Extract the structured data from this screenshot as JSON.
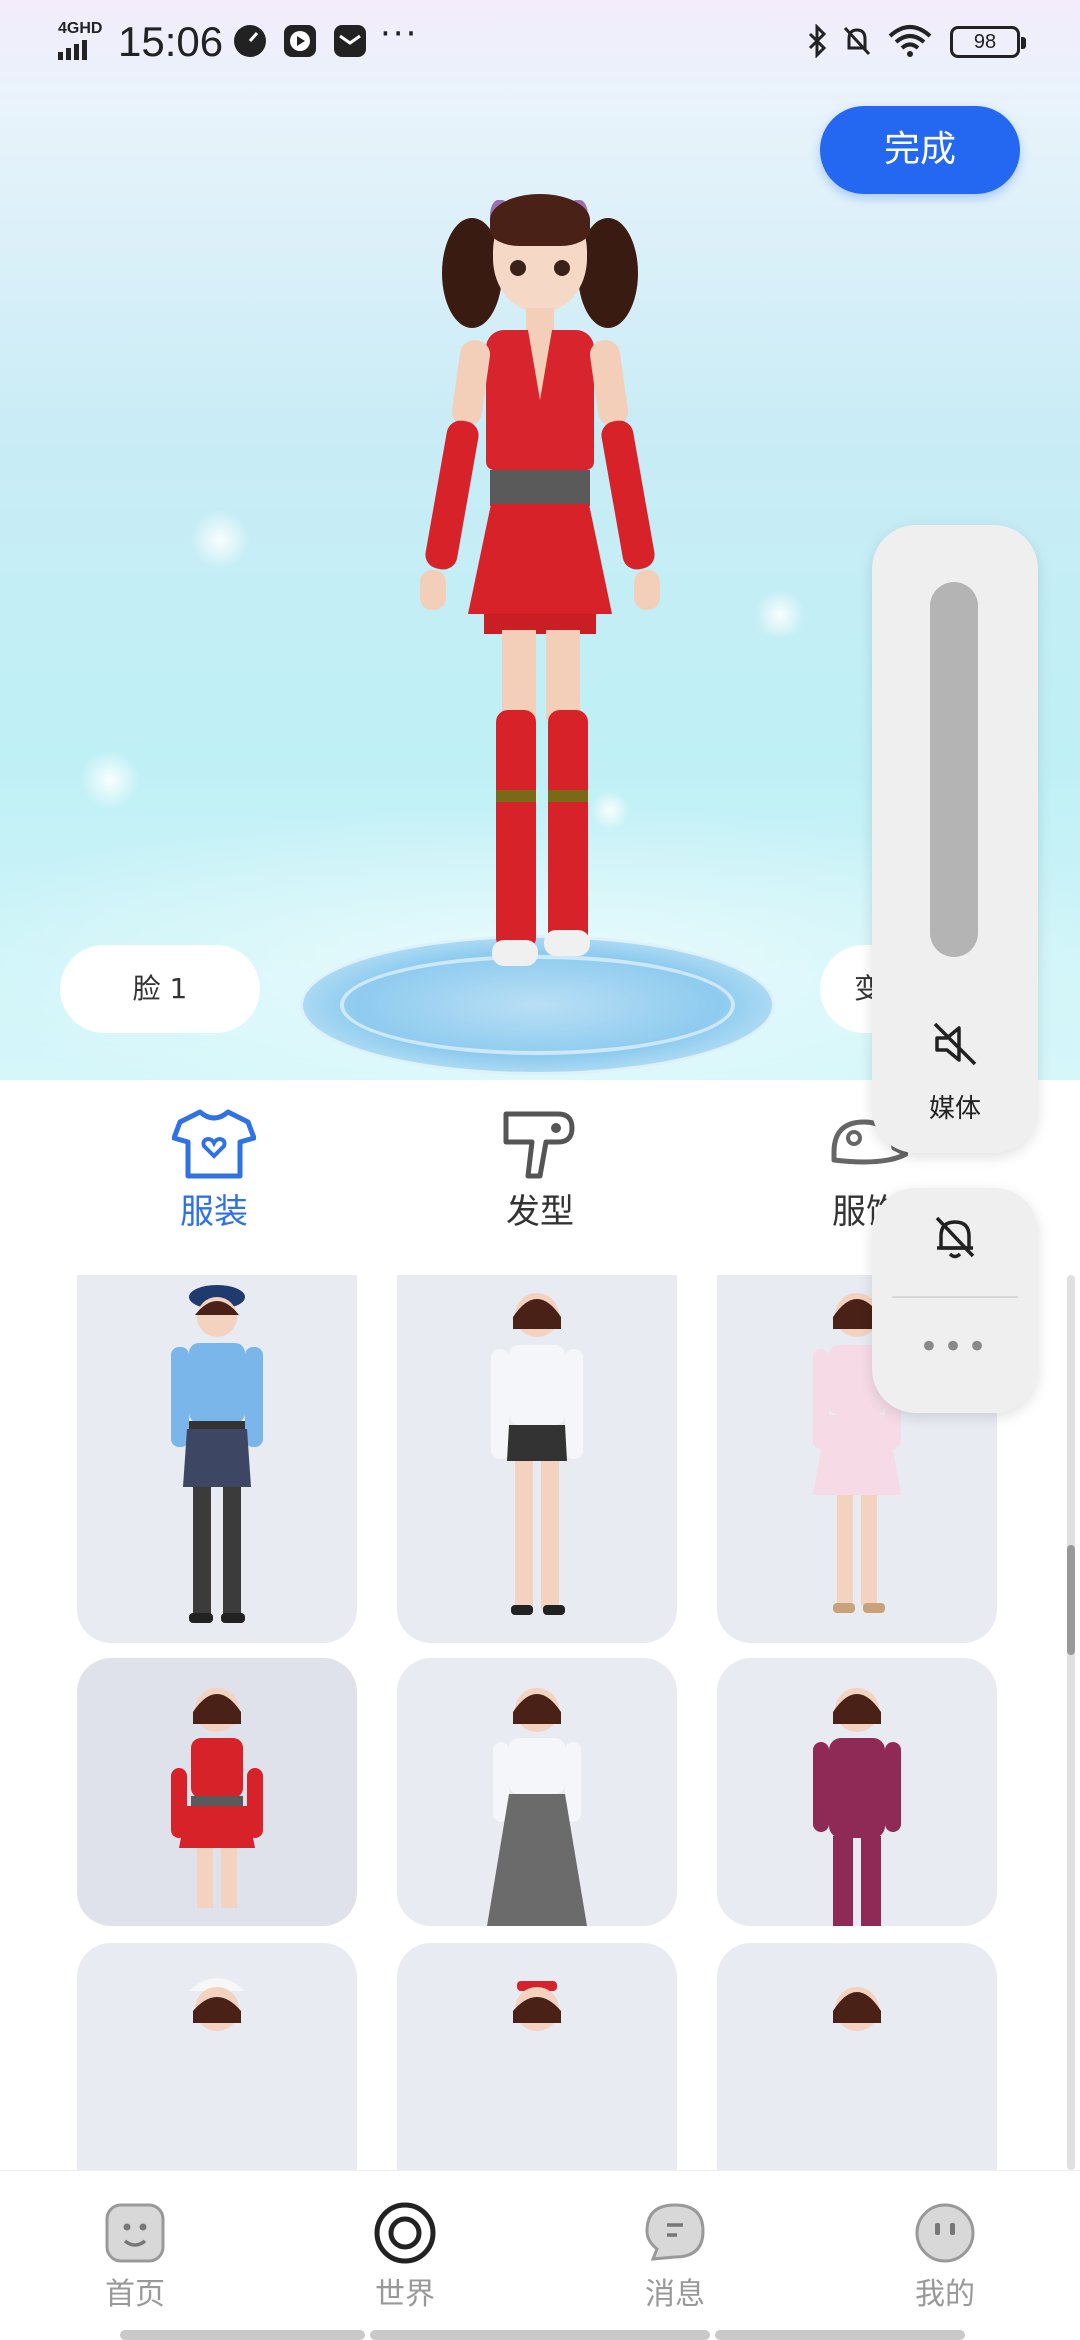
{
  "status_bar": {
    "network": "4GHD",
    "time": "15:06",
    "more": "···",
    "battery": "98"
  },
  "header": {
    "done_label": "完成"
  },
  "scene": {
    "face_label": "脸 1",
    "change_label": "变"
  },
  "tabs": [
    {
      "label": "服装",
      "icon": "tshirt-icon",
      "active": true
    },
    {
      "label": "发型",
      "icon": "hair-dryer-icon",
      "active": false
    },
    {
      "label": "服饰",
      "icon": "cap-icon",
      "active": false
    }
  ],
  "outfits": [
    {
      "name": "police-uniform",
      "selected": false
    },
    {
      "name": "white-blouse-skirt",
      "selected": false
    },
    {
      "name": "pink-dress",
      "selected": false
    },
    {
      "name": "red-ninja-dress",
      "selected": true
    },
    {
      "name": "long-gray-skirt",
      "selected": false
    },
    {
      "name": "maroon-jumpsuit",
      "selected": false
    },
    {
      "name": "white-hat-outfit",
      "selected": false
    },
    {
      "name": "red-headband-outfit",
      "selected": false
    },
    {
      "name": "outfit-9",
      "selected": false
    }
  ],
  "volume_panel": {
    "media_label": "媒体",
    "more": "•••"
  },
  "bottom_nav": [
    {
      "label": "首页",
      "icon": "home-face-icon",
      "active": false
    },
    {
      "label": "世界",
      "icon": "world-icon",
      "active": true
    },
    {
      "label": "消息",
      "icon": "message-icon",
      "active": false
    },
    {
      "label": "我的",
      "icon": "profile-face-icon",
      "active": false
    }
  ],
  "colors": {
    "accent": "#2468f2",
    "tab_active": "#2f72e6",
    "card_bg": "#e8ebf2"
  }
}
